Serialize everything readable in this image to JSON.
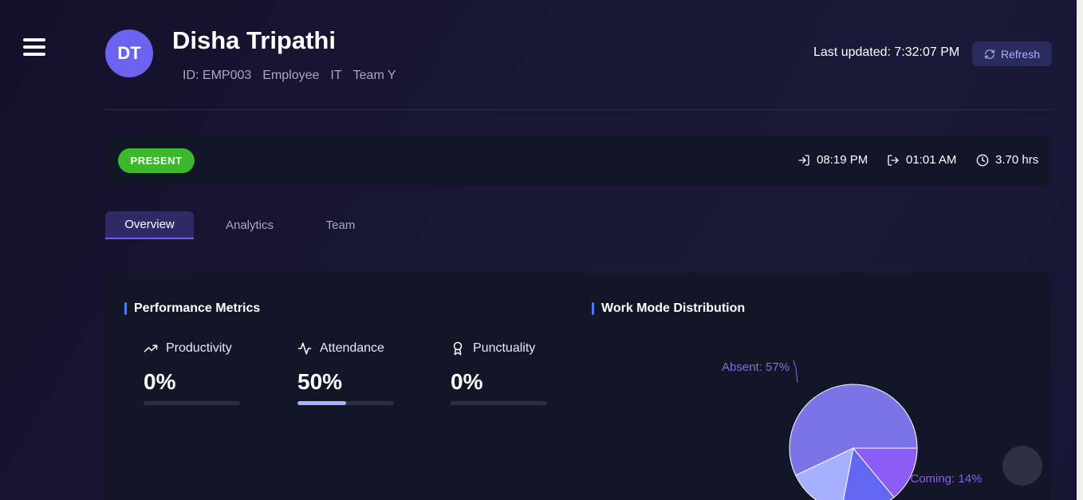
{
  "header": {
    "avatar_initials": "DT",
    "name": "Disha Tripathi",
    "meta": [
      "ID: EMP003",
      "Employee",
      "IT",
      "Team Y"
    ],
    "last_updated": "Last updated: 7:32:07 PM",
    "refresh_label": "Refresh"
  },
  "status": {
    "badge": "PRESENT",
    "badge_color": "#3cb82c",
    "check_in": "08:19 PM",
    "check_out": "01:01 AM",
    "duration": "3.70 hrs"
  },
  "tabs": [
    {
      "label": "Overview",
      "active": true
    },
    {
      "label": "Analytics",
      "active": false
    },
    {
      "label": "Team",
      "active": false
    }
  ],
  "performance": {
    "title": "Performance Metrics",
    "metrics": [
      {
        "label": "Productivity",
        "value": "0%",
        "fraction": 0.0,
        "icon": "trending-up-icon"
      },
      {
        "label": "Attendance",
        "value": "50%",
        "fraction": 0.5,
        "icon": "activity-icon"
      },
      {
        "label": "Punctuality",
        "value": "0%",
        "fraction": 0.0,
        "icon": "award-icon"
      }
    ]
  },
  "work_mode": {
    "title": "Work Mode Distribution",
    "label_absent": "Absent: 57%",
    "label_late": "Late Coming: 14%"
  },
  "chart_data": {
    "type": "pie",
    "slices": [
      {
        "label": "Absent",
        "value": 57,
        "color": "#7b73e8"
      },
      {
        "label": "Late Coming",
        "value": 14,
        "color": "#8b5cf6"
      },
      {
        "label": "",
        "value": 14,
        "color": "#6366f1"
      },
      {
        "label": "",
        "value": 15,
        "color": "#a5b0ff"
      }
    ]
  }
}
